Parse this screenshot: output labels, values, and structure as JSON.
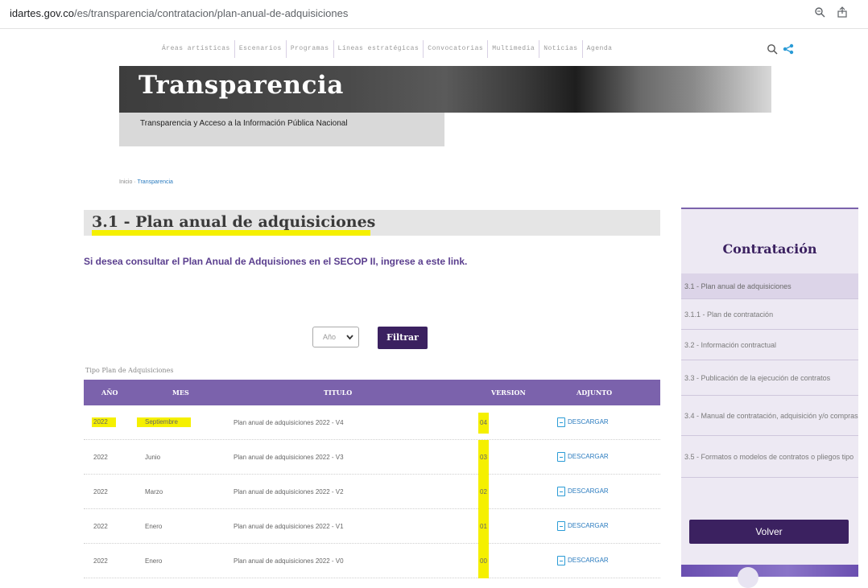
{
  "browser": {
    "url_domain": "idartes.gov.co",
    "url_path": "/es/transparencia/contratacion/plan-anual-de-adquisiciones"
  },
  "topnav": {
    "items": [
      "Áreas artísticas",
      "Escenarios",
      "Programas",
      "Líneas estratégicas",
      "Convocatorias",
      "Multimedia",
      "Noticias",
      "Agenda"
    ]
  },
  "banner": {
    "title": "Transparencia",
    "subtitle": "Transparencia y Acceso a la Información Pública Nacional"
  },
  "breadcrumb": {
    "home": "Inicio",
    "current": "Transparencia"
  },
  "page": {
    "heading": "3.1 - Plan anual de adquisiciones",
    "intro": "Si desea consultar el Plan Anual de Adquisiones en el SECOP II, ingrese a este link."
  },
  "filter": {
    "year_placeholder": "Año",
    "button_label": "Filtrar"
  },
  "table": {
    "caption": "Tipo Plan de Adquisiciones",
    "headers": {
      "year": "AÑO",
      "month": "MES",
      "title": "TITULO",
      "version": "VERSION",
      "attachment": "ADJUNTO"
    },
    "rows": [
      {
        "year": "2022",
        "month": "Septiembre",
        "title": "Plan anual de adquisiciones 2022 - V4",
        "version": "04",
        "download": "DESCARGAR"
      },
      {
        "year": "2022",
        "month": "Junio",
        "title": "Plan anual de adquisiciones 2022 - V3",
        "version": "03",
        "download": "DESCARGAR"
      },
      {
        "year": "2022",
        "month": "Marzo",
        "title": "Plan anual de adquisiciones 2022 - V2",
        "version": "02",
        "download": "DESCARGAR"
      },
      {
        "year": "2022",
        "month": "Enero",
        "title": "Plan anual de adquisiciones 2022 - V1",
        "version": "01",
        "download": "DESCARGAR"
      },
      {
        "year": "2022",
        "month": "Enero",
        "title": "Plan anual de adquisiciones 2022 - V0",
        "version": "00",
        "download": "DESCARGAR"
      }
    ]
  },
  "sidebar": {
    "title": "Contratación",
    "items": [
      "3.1 - Plan anual de adquisiciones",
      "3.1.1 - Plan de contratación",
      "3.2 - Información contractual",
      "3.3 - Publicación de la ejecución de contratos",
      "3.4 - Manual de contratación, adquisición y/o compras",
      "3.5 - Formatos o modelos de contratos o pliegos tipo"
    ],
    "back_label": "Volver"
  },
  "icons": {
    "zoom": "zoom-icon",
    "share_browser": "share-icon",
    "site_search": "search-icon",
    "site_share": "share-nodes-icon",
    "file": "file-icon",
    "chevron": "chevron-down-icon"
  },
  "colors": {
    "primary": "#3b2160",
    "table_header": "#7b62ac",
    "highlight": "#f5f000",
    "link": "#2a7bbf"
  }
}
